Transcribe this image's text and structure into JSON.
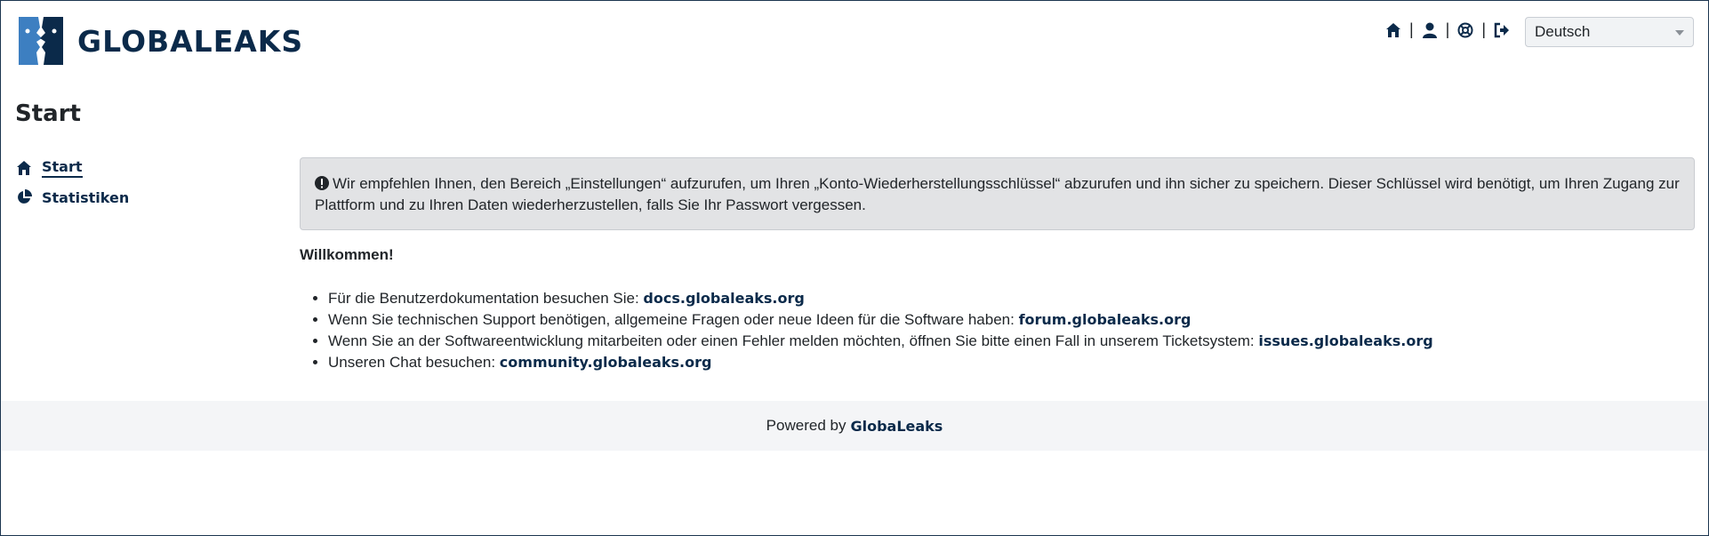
{
  "brand": {
    "name": "GLOBALEAKS"
  },
  "topnav": {
    "icons": [
      "home-icon",
      "user-icon",
      "support-icon",
      "logout-icon"
    ],
    "separator": "|"
  },
  "language": {
    "selected": "Deutsch"
  },
  "page": {
    "title": "Start"
  },
  "sidebar": {
    "items": [
      {
        "label": "Start",
        "icon": "home-icon"
      },
      {
        "label": "Statistiken",
        "icon": "pie-chart-icon"
      }
    ]
  },
  "alert": {
    "icon": "exclamation-circle-icon",
    "text": "Wir empfehlen Ihnen, den Bereich „Einstellungen“ aufzurufen, um Ihren „Konto-Wiederherstellungsschlüssel“ abzurufen und ihn sicher zu speichern. Dieser Schlüssel wird benötigt, um Ihren Zugang zur Plattform und zu Ihren Daten wiederherzustellen, falls Sie Ihr Passwort vergessen."
  },
  "welcome": "Willkommen!",
  "links": [
    {
      "text": "Für die Benutzerdokumentation besuchen Sie:",
      "link": "docs.globaleaks.org"
    },
    {
      "text": "Wenn Sie technischen Support benötigen, allgemeine Fragen oder neue Ideen für die Software haben:",
      "link": "forum.globaleaks.org"
    },
    {
      "text": "Wenn Sie an der Softwareentwicklung mitarbeiten oder einen Fehler melden möchten, öffnen Sie bitte einen Fall in unserem Ticketsystem:",
      "link": "issues.globaleaks.org"
    },
    {
      "text": "Unseren Chat besuchen:",
      "link": "community.globaleaks.org"
    }
  ],
  "footer": {
    "prefix": "Powered by",
    "link": "GlobaLeaks"
  },
  "colors": {
    "brand": "#0b2a4a",
    "logo_blue": "#3d7fc1",
    "alert_bg": "#e2e3e5",
    "footer_bg": "#f4f5f7"
  }
}
